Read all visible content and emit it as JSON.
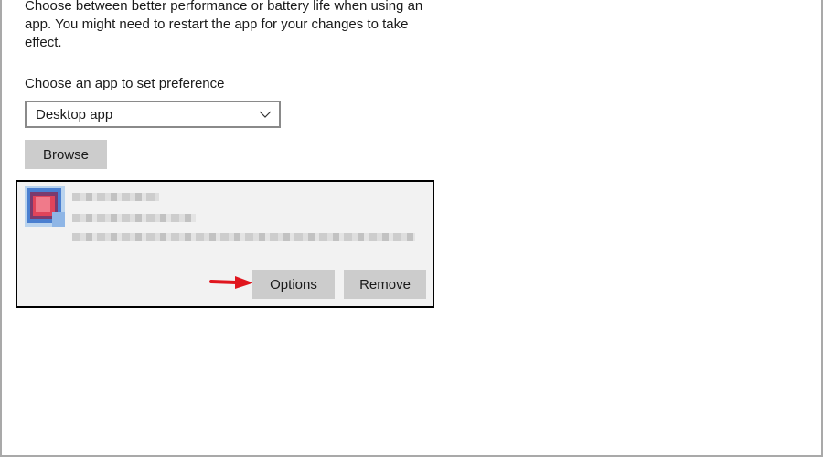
{
  "intro_text": "Choose between better performance or battery life when using an app. You might need to restart the app for your changes to take effect.",
  "choose_label": "Choose an app to set preference",
  "app_type_select": {
    "value": "Desktop app"
  },
  "browse_label": "Browse",
  "app_card": {
    "options_label": "Options",
    "remove_label": "Remove"
  },
  "colors": {
    "button_bg": "#cccccc",
    "card_bg": "#f2f2f2",
    "card_border": "#000000",
    "arrow": "#e0161e"
  },
  "icons": {
    "select_chevron": "chevron-down-icon",
    "app_icon": "app-icon",
    "annotation_arrow": "arrow-right-icon"
  }
}
